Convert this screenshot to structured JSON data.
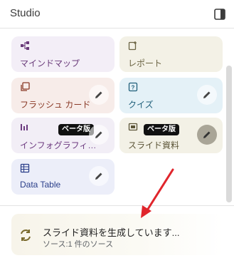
{
  "header": {
    "title": "Studio"
  },
  "tiles": [
    {
      "label": "マインドマップ"
    },
    {
      "label": "レポート"
    },
    {
      "label": "フラッシュ カード"
    },
    {
      "label": "クイズ"
    },
    {
      "label": "インフォグラフィ…",
      "badge": "ベータ版"
    },
    {
      "label": "スライド資料",
      "badge": "ベータ版"
    },
    {
      "label": "Data Table"
    }
  ],
  "status": {
    "title": "スライド資料を生成しています...",
    "subtitle": "ソース:1 件のソース"
  },
  "colors": {
    "mindmap_bg": "#f3eef7",
    "mindmap_fg": "#6a3b7a",
    "report_bg": "#f3f1e6",
    "report_fg": "#6b6443",
    "flash_bg": "#f7ece9",
    "flash_fg": "#8a3a27",
    "quiz_bg": "#e4f1f7",
    "quiz_fg": "#1f5f7a",
    "info_bg": "#f2eef6",
    "info_fg": "#6d3b80",
    "slide_bg": "#f3f1e6",
    "slide_fg": "#5b5436",
    "table_bg": "#eceef9",
    "table_fg": "#2b3f8a",
    "arrow": "#e0252c"
  }
}
